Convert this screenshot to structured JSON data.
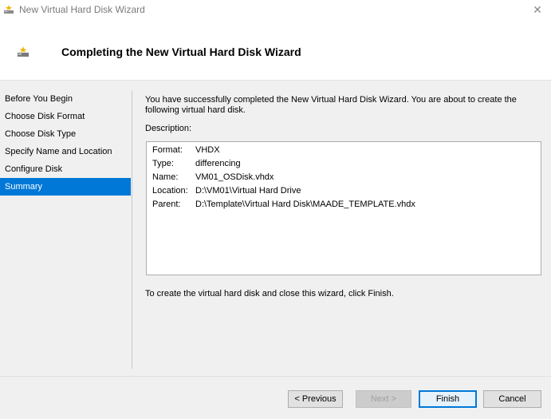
{
  "window": {
    "title": "New Virtual Hard Disk Wizard",
    "close_glyph": "✕"
  },
  "header": {
    "title": "Completing the New Virtual Hard Disk Wizard"
  },
  "nav": {
    "items": [
      {
        "label": "Before You Begin"
      },
      {
        "label": "Choose Disk Format"
      },
      {
        "label": "Choose Disk Type"
      },
      {
        "label": "Specify Name and Location"
      },
      {
        "label": "Configure Disk"
      },
      {
        "label": "Summary"
      }
    ],
    "selected": "Summary"
  },
  "content": {
    "intro": "You have successfully completed the New Virtual Hard Disk Wizard. You are about to create the following virtual hard disk.",
    "description_label": "Description:",
    "description": [
      {
        "key": "Format:",
        "value": "VHDX"
      },
      {
        "key": "Type:",
        "value": "differencing"
      },
      {
        "key": "Name:",
        "value": "VM01_OSDisk.vhdx"
      },
      {
        "key": "Location:",
        "value": "D:\\VM01\\Virtual Hard Drive"
      },
      {
        "key": "Parent:",
        "value": "D:\\Template\\Virtual Hard Disk\\MAADE_TEMPLATE.vhdx"
      }
    ],
    "outro": "To create the virtual hard disk and close this wizard, click Finish."
  },
  "footer": {
    "previous_label": "< Previous",
    "next_label": "Next >",
    "finish_label": "Finish",
    "cancel_label": "Cancel"
  },
  "colors": {
    "selection": "#0078d7"
  }
}
